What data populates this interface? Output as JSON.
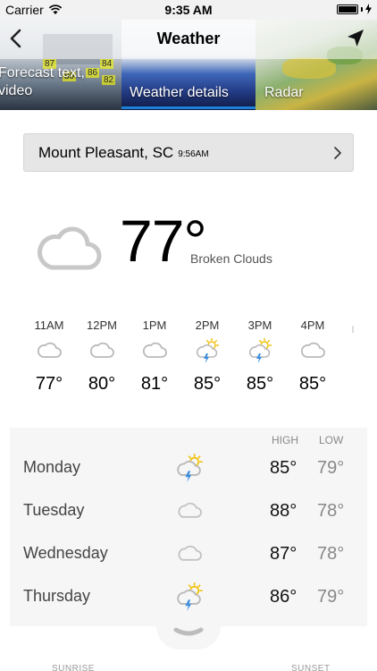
{
  "status_bar": {
    "carrier": "Carrier",
    "time": "9:35 AM"
  },
  "header": {
    "title": "Weather",
    "tabs": [
      {
        "label": "Forecast text, video",
        "line1": "Forecast text,",
        "line2": "video"
      },
      {
        "label": "Weather details",
        "active": true
      },
      {
        "label": "Radar"
      }
    ],
    "thumb_labels": [
      "87",
      "80",
      "84",
      "86",
      "82"
    ],
    "accent_color": "#1e7fd8"
  },
  "location": {
    "name": "Mount Pleasant, SC",
    "time": "9:56AM"
  },
  "current": {
    "temp": "77°",
    "condition": "Broken Clouds",
    "icon": "cloud-icon"
  },
  "hourly": [
    {
      "time": "11AM",
      "icon": "cloud-icon",
      "temp": "77°"
    },
    {
      "time": "12PM",
      "icon": "cloud-icon",
      "temp": "80°"
    },
    {
      "time": "1PM",
      "icon": "cloud-icon",
      "temp": "81°"
    },
    {
      "time": "2PM",
      "icon": "storm-sun-icon",
      "temp": "85°"
    },
    {
      "time": "3PM",
      "icon": "storm-sun-icon",
      "temp": "85°"
    },
    {
      "time": "4PM",
      "icon": "cloud-icon",
      "temp": "85°"
    }
  ],
  "daily": {
    "high_label": "HIGH",
    "low_label": "LOW",
    "days": [
      {
        "name": "Monday",
        "icon": "storm-sun-icon",
        "high": "85°",
        "low": "79°"
      },
      {
        "name": "Tuesday",
        "icon": "cloud-icon",
        "high": "88°",
        "low": "78°"
      },
      {
        "name": "Wednesday",
        "icon": "cloud-icon",
        "high": "87°",
        "low": "78°"
      },
      {
        "name": "Thursday",
        "icon": "storm-sun-icon",
        "high": "86°",
        "low": "79°"
      }
    ]
  },
  "bottom": {
    "sunrise_label": "SUNRISE",
    "sunset_label": "SUNSET"
  }
}
